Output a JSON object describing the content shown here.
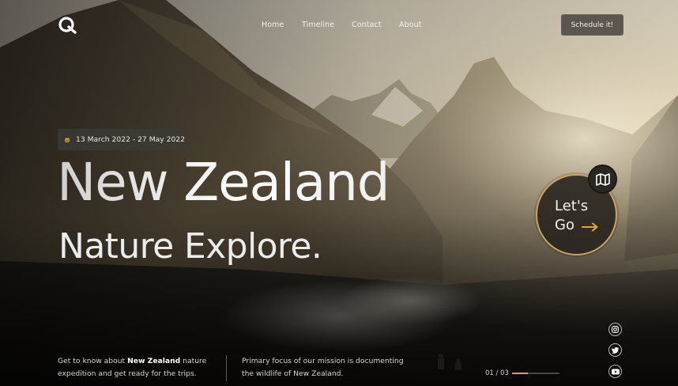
{
  "header": {
    "nav": [
      "Home",
      "Timeline",
      "Contact",
      "About"
    ],
    "schedule_label": "Schedule it!"
  },
  "hero": {
    "date_range": "13 March 2022 - 27 May 2022",
    "title": "New Zealand",
    "subtitle": "Nature Explore.",
    "cta_line1": "Let's",
    "cta_line2": "Go"
  },
  "footer": {
    "desc1_pre": "Get to know about ",
    "desc1_bold": "New Zealand",
    "desc1_post": " nature expedition and get ready for the trips.",
    "desc2": "Primary focus of our mission is documenting the wildlife of New Zealand.",
    "pager": "01 / 03",
    "progress": 0.33
  },
  "icons": {
    "logo": "logo-icon",
    "calendar": "calendar-icon",
    "map": "map-icon",
    "arrow": "arrow-right-icon",
    "social": [
      "instagram-icon",
      "twitter-icon",
      "youtube-icon"
    ]
  },
  "colors": {
    "accent": "#d9a64a",
    "ring": "#c9a25f"
  }
}
